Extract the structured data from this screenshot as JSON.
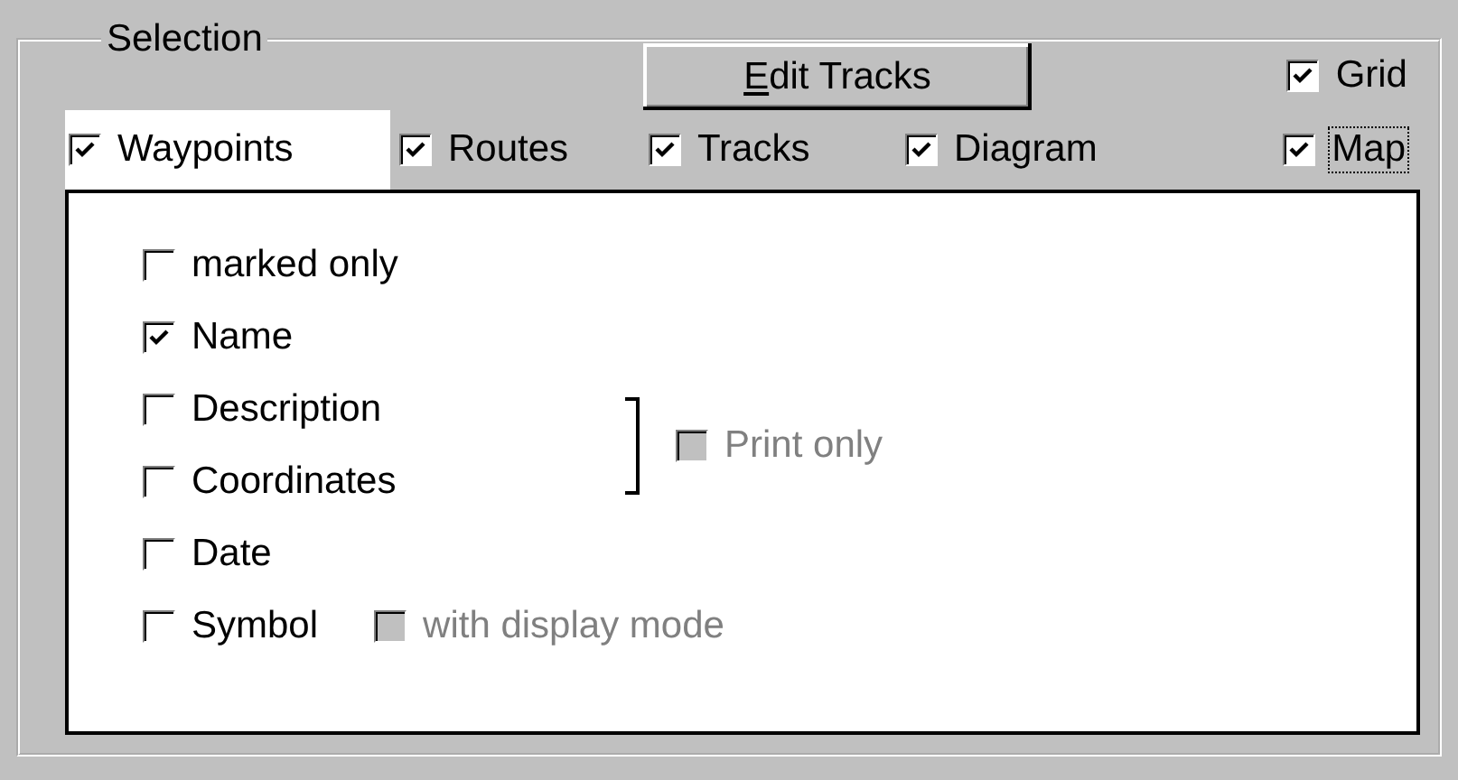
{
  "group": {
    "title": "Selection"
  },
  "edit_button": {
    "label": "Edit Tracks"
  },
  "grid": {
    "label": "Grid",
    "checked": true
  },
  "layers": [
    {
      "label": "Waypoints",
      "checked": true,
      "selected": true,
      "focused": false
    },
    {
      "label": "Routes",
      "checked": true,
      "selected": false,
      "focused": false
    },
    {
      "label": "Tracks",
      "checked": true,
      "selected": false,
      "focused": false
    },
    {
      "label": "Diagram",
      "checked": true,
      "selected": false,
      "focused": false
    },
    {
      "label": "Map",
      "checked": true,
      "selected": false,
      "focused": true
    }
  ],
  "options": [
    {
      "kind": "check",
      "label": "marked only",
      "checked": false
    },
    {
      "kind": "check",
      "label": "Name",
      "checked": true
    },
    {
      "kind": "group",
      "items": [
        {
          "label": "Description",
          "checked": false
        },
        {
          "label": "Coordinates",
          "checked": false
        }
      ],
      "print_only": {
        "label": "Print only",
        "checked": false,
        "disabled": true
      }
    },
    {
      "kind": "check",
      "label": "Date",
      "checked": false
    },
    {
      "kind": "check",
      "label": "Symbol",
      "checked": false,
      "sub": {
        "label": "with display mode",
        "checked": false,
        "disabled": true
      }
    }
  ]
}
